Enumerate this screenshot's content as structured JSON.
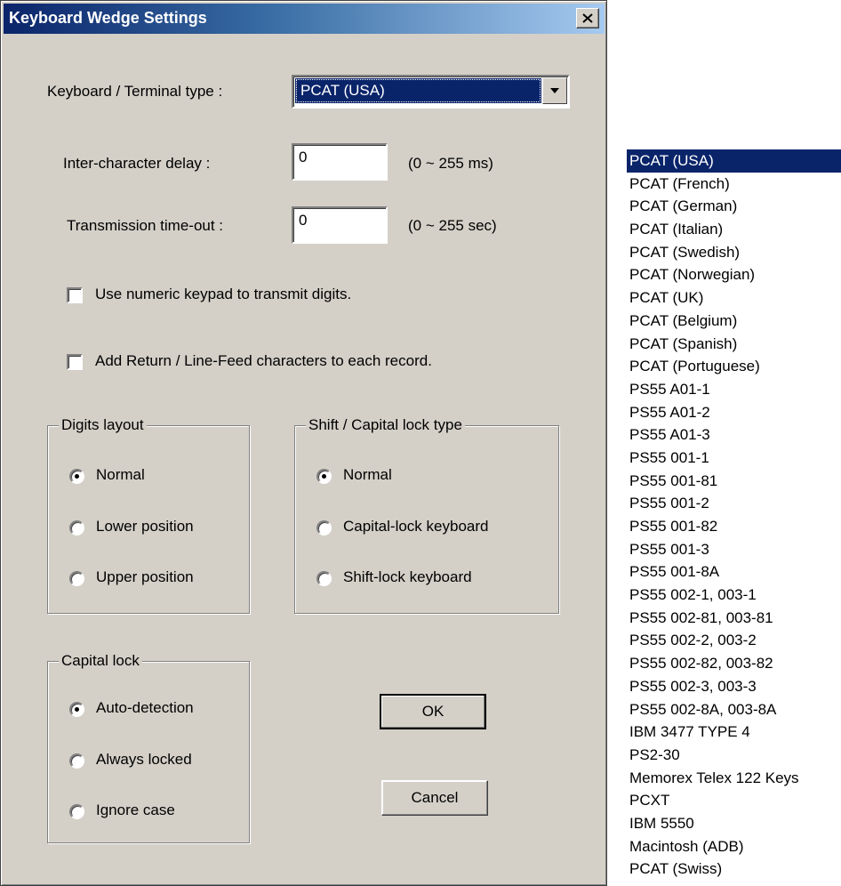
{
  "dialog": {
    "title": "Keyboard Wedge Settings",
    "close_label": "×"
  },
  "keyboard_type": {
    "label": "Keyboard / Terminal type :",
    "selected": "PCAT (USA)"
  },
  "inter_char_delay": {
    "label": "Inter-character delay :",
    "value": "0",
    "range": "(0 ~ 255 ms)"
  },
  "transmission_timeout": {
    "label": "Transmission time-out :",
    "value": "0",
    "range": "(0 ~ 255 sec)"
  },
  "checkboxes": {
    "numeric_keypad": {
      "label": "Use numeric keypad to transmit digits.",
      "checked": false
    },
    "return_linefeed": {
      "label": "Add Return / Line-Feed characters to each record.",
      "checked": false
    }
  },
  "digits_layout": {
    "title": "Digits layout",
    "options": [
      "Normal",
      "Lower position",
      "Upper position"
    ],
    "selected": "Normal"
  },
  "shift_lock": {
    "title": "Shift / Capital lock type",
    "options": [
      "Normal",
      "Capital-lock keyboard",
      "Shift-lock keyboard"
    ],
    "selected": "Normal"
  },
  "capital_lock": {
    "title": "Capital lock",
    "options": [
      "Auto-detection",
      "Always locked",
      "Ignore case"
    ],
    "selected": "Auto-detection"
  },
  "buttons": {
    "ok": "OK",
    "cancel": "Cancel"
  },
  "dropdown": {
    "selected": "PCAT (USA)",
    "items": [
      "PCAT (USA)",
      "PCAT (French)",
      "PCAT (German)",
      "PCAT (Italian)",
      "PCAT (Swedish)",
      "PCAT (Norwegian)",
      "PCAT (UK)",
      "PCAT (Belgium)",
      "PCAT (Spanish)",
      "PCAT (Portuguese)",
      "PS55 A01-1",
      "PS55 A01-2",
      "PS55 A01-3",
      "PS55 001-1",
      "PS55 001-81",
      "PS55 001-2",
      "PS55 001-82",
      "PS55 001-3",
      "PS55 001-8A",
      "PS55 002-1, 003-1",
      "PS55 002-81, 003-81",
      "PS55 002-2, 003-2",
      "PS55 002-82, 003-82",
      "PS55 002-3, 003-3",
      "PS55 002-8A, 003-8A",
      "IBM 3477 TYPE 4",
      "PS2-30",
      "Memorex Telex 122 Keys",
      "PCXT",
      "IBM 5550",
      "Macintosh (ADB)",
      "PCAT (Swiss)"
    ]
  }
}
